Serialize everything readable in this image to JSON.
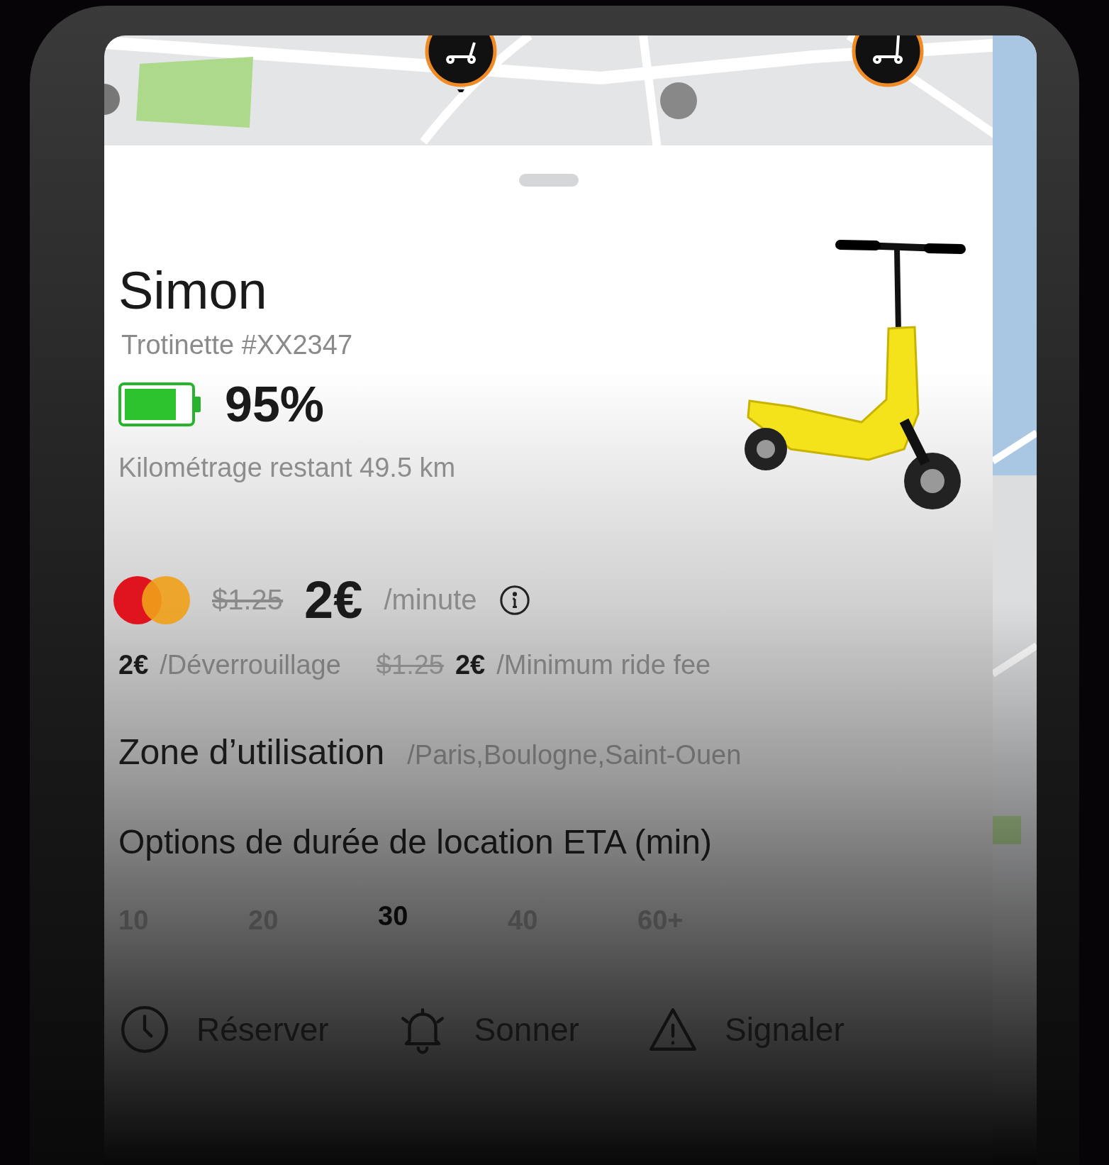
{
  "vehicle": {
    "name": "Simon",
    "id": "Trotinette #XX2347",
    "battery_reading": "95%",
    "range": "Kilométrage restant 49.5 km"
  },
  "pricing": {
    "old_price": "$1.25",
    "price": "2€",
    "unit": "/minute",
    "fees": [
      {
        "amount": "2€",
        "label": "/Déverrouillage"
      },
      {
        "old_amount": "$1.25",
        "amount": "2€",
        "label": "/Minimum ride fee"
      }
    ]
  },
  "zone": {
    "title": "Zone d’utilisation",
    "value": "/Paris,Boulogne,Saint-Ouen"
  },
  "durations": {
    "title": "Options de durée de location ETA (min)",
    "options": [
      {
        "label": "10",
        "selected": false
      },
      {
        "label": "20",
        "selected": false
      },
      {
        "label": "30",
        "selected": true
      },
      {
        "label": "40",
        "selected": false
      },
      {
        "label": "60+",
        "selected": false
      }
    ]
  },
  "actions": [
    {
      "kind": "reserve",
      "label": "Réserver"
    },
    {
      "kind": "ring",
      "label": "Sonner"
    },
    {
      "kind": "report",
      "label": "Signaler"
    }
  ]
}
